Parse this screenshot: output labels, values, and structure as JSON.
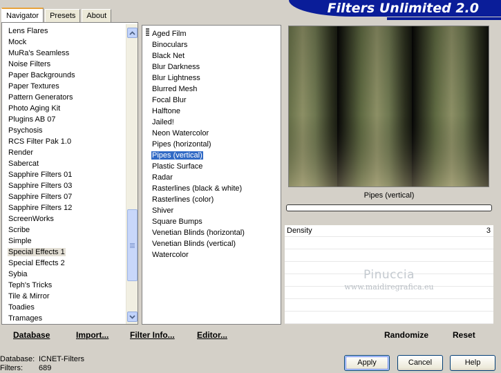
{
  "tabs": [
    {
      "label": "Navigator",
      "active": true
    },
    {
      "label": "Presets",
      "active": false
    },
    {
      "label": "About",
      "active": false
    }
  ],
  "banner": {
    "title": "Filters Unlimited 2.0"
  },
  "categories": {
    "items": [
      "Lens Flares",
      "Mock",
      "MuRa's Seamless",
      "Noise Filters",
      "Paper Backgrounds",
      "Paper Textures",
      "Pattern Generators",
      "Photo Aging Kit",
      "Plugins AB 07",
      "Psychosis",
      "RCS Filter Pak 1.0",
      "Render",
      "Sabercat",
      "Sapphire Filters 01",
      "Sapphire Filters 03",
      "Sapphire Filters 07",
      "Sapphire Filters 12",
      "ScreenWorks",
      "Scribe",
      "Simple",
      "Special Effects 1",
      "Special Effects 2",
      "Sybia",
      "Teph's Tricks",
      "Tile & Mirror",
      "Toadies",
      "Tramages"
    ],
    "selected": "Special Effects 1"
  },
  "filters": {
    "items": [
      "Aged Film",
      "Binoculars",
      "Black Net",
      "Blur Darkness",
      "Blur Lightness",
      "Blurred Mesh",
      "Focal Blur",
      "Halftone",
      "Jailed!",
      "Neon Watercolor",
      "Pipes (horizontal)",
      "Pipes (vertical)",
      "Plastic Surface",
      "Radar",
      "Rasterlines (black & white)",
      "Rasterlines (color)",
      "Shiver",
      "Square Bumps",
      "Venetian Blinds (horizontal)",
      "Venetian Blinds (vertical)",
      "Watercolor"
    ],
    "selected": "Pipes (vertical)"
  },
  "preview": {
    "label": "Pipes (vertical)",
    "progress": 0
  },
  "params": [
    {
      "name": "Density",
      "value": "3"
    }
  ],
  "watermark": {
    "line1": "Pinuccia",
    "line2": "www.maidiregrafica.eu"
  },
  "toolbar": {
    "database": "Database",
    "import": "Import...",
    "filter_info": "Filter Info...",
    "editor": "Editor...",
    "randomize": "Randomize",
    "reset": "Reset"
  },
  "status": {
    "database_key": "Database:",
    "database_value": "ICNET-Filters",
    "filters_key": "Filters:",
    "filters_value": "689"
  },
  "buttons": {
    "apply": "Apply",
    "cancel": "Cancel",
    "help": "Help"
  },
  "colors": {
    "banner": "#0a1d99",
    "selection": "#316ac5",
    "tab_accent": "#e8a23a"
  }
}
